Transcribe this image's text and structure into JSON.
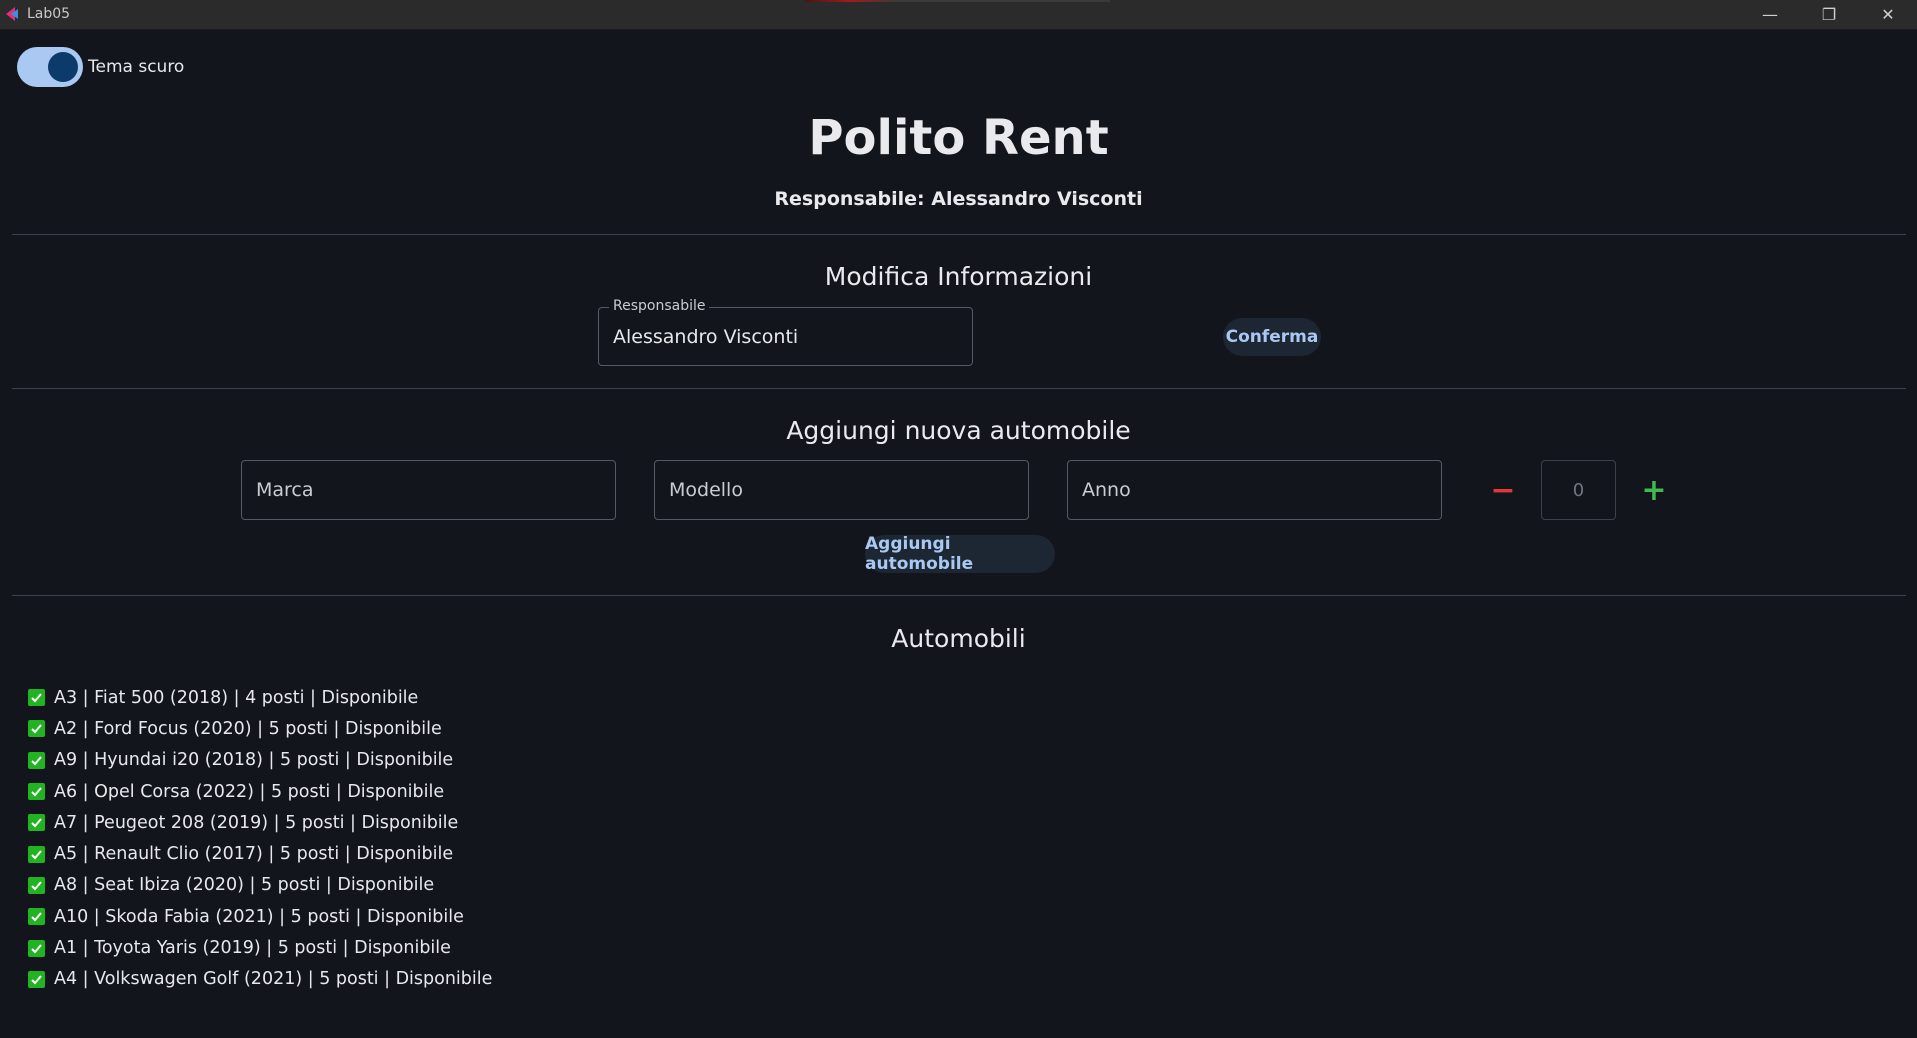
{
  "window": {
    "title": "Lab05",
    "minimize_glyph": "—",
    "maximize_glyph": "❐",
    "close_glyph": "✕"
  },
  "theme_toggle": {
    "label": "Tema scuro",
    "checked": true
  },
  "header": {
    "title": "Polito Rent",
    "subtitle": "Responsabile: Alessandro Visconti"
  },
  "edit_section": {
    "title": "Modifica Informazioni",
    "responsabile_label": "Responsabile",
    "responsabile_value": "Alessandro Visconti",
    "confirm_button": "Conferma"
  },
  "add_section": {
    "title": "Aggiungi nuova automobile",
    "marca_placeholder": "Marca",
    "modello_placeholder": "Modello",
    "anno_placeholder": "Anno",
    "seats_minus": "−",
    "seats_value": "0",
    "seats_plus": "+",
    "add_button": "Aggiungi automobile"
  },
  "cars_section": {
    "title": "Automobili",
    "items": [
      "A3 | Fiat 500 (2018) | 4 posti | Disponibile",
      "A2 | Ford Focus (2020) | 5 posti | Disponibile",
      "A9 | Hyundai i20 (2018) | 5 posti | Disponibile",
      "A6 | Opel Corsa (2022) | 5 posti | Disponibile",
      "A7 | Peugeot 208 (2019) | 5 posti | Disponibile",
      "A5 | Renault Clio (2017) | 5 posti | Disponibile",
      "A8 | Seat Ibiza (2020) | 5 posti | Disponibile",
      "A10 | Skoda Fabia (2021) | 5 posti | Disponibile",
      "A1 | Toyota Yaris (2019) | 5 posti | Disponibile",
      "A4 | Volkswagen Golf (2021) | 5 posti | Disponibile"
    ]
  },
  "colors": {
    "background": "#12161c",
    "accent": "#a9c8f2",
    "check_green": "#22b322",
    "minus_red": "#e53935",
    "plus_green": "#3fb950"
  }
}
